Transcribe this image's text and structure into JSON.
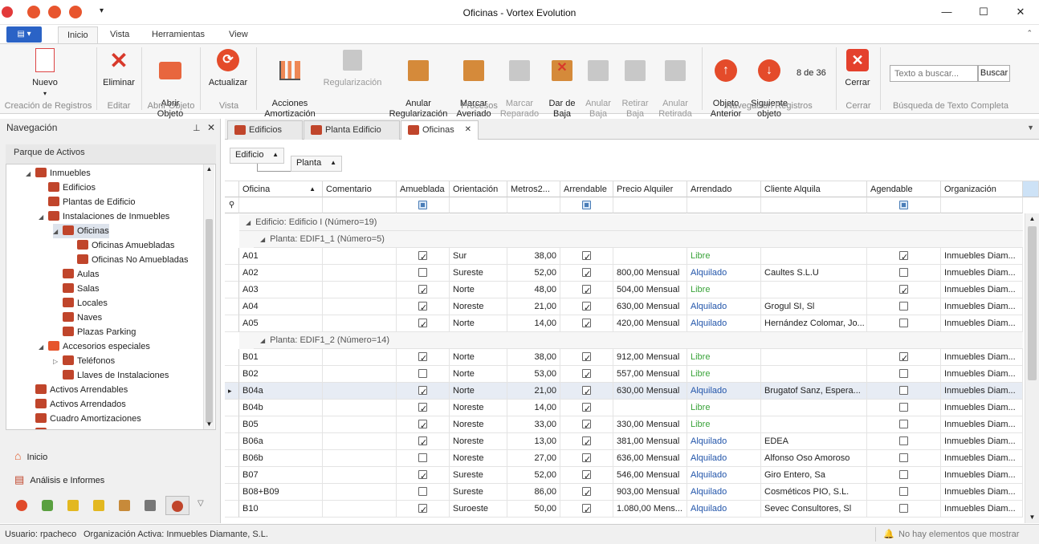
{
  "window": {
    "title": "Oficinas - Vortex Evolution"
  },
  "ribbon_tabs": [
    "Inicio",
    "Vista",
    "Herramientas",
    "View"
  ],
  "ribbon": {
    "nuevo": "Nuevo",
    "eliminar": "Eliminar",
    "abrir": "Abrir\nObjeto",
    "actualizar": "Actualizar",
    "acciones": "Acciones\nAmortización",
    "regularizacion": "Regularización",
    "anular_reg": "Anular\nRegularización",
    "marcar_averiado": "Marcar\nAveriado",
    "marcar_reparado": "Marcar\nReparado",
    "dar_baja": "Dar de\nBaja",
    "anular_baja": "Anular\nBaja",
    "retirar_baja": "Retirar\nBaja",
    "anular_retirada": "Anular\nRetirada",
    "objeto_anterior": "Objeto\nAnterior",
    "siguiente_objeto": "Siguiente\nobjeto",
    "counter": "8 de 36",
    "cerrar": "Cerrar",
    "search_placeholder": "Texto a buscar...",
    "buscar": "Buscar",
    "groups": {
      "creacion": "Creación de Registros",
      "editar": "Editar",
      "abrir": "Abrir Objeto",
      "vista": "Vista",
      "procesos": "Procesos",
      "navegacion": "Navegación Registros",
      "cerrar": "Cerrar",
      "busqueda": "Búsqueda de Texto Completa"
    }
  },
  "nav": {
    "title": "Navegación",
    "section": "Parque de Activos",
    "tree": [
      {
        "label": "Inmuebles",
        "level": 0,
        "exp": "◢"
      },
      {
        "label": "Edificios",
        "level": 1,
        "exp": ""
      },
      {
        "label": "Plantas de Edificio",
        "level": 1,
        "exp": ""
      },
      {
        "label": "Instalaciones de Inmuebles",
        "level": 1,
        "exp": "◢"
      },
      {
        "label": "Oficinas",
        "level": 2,
        "exp": "◢",
        "selected": true
      },
      {
        "label": "Oficinas Amuebladas",
        "level": 3,
        "exp": ""
      },
      {
        "label": "Oficinas No Amuebladas",
        "level": 3,
        "exp": ""
      },
      {
        "label": "Aulas",
        "level": 2,
        "exp": ""
      },
      {
        "label": "Salas",
        "level": 2,
        "exp": ""
      },
      {
        "label": "Locales",
        "level": 2,
        "exp": ""
      },
      {
        "label": "Naves",
        "level": 2,
        "exp": ""
      },
      {
        "label": "Plazas Parking",
        "level": 2,
        "exp": ""
      },
      {
        "label": "Accesorios especiales",
        "level": 1,
        "exp": "◢"
      },
      {
        "label": "Teléfonos",
        "level": 2,
        "exp": "▷"
      },
      {
        "label": "Llaves de Instalaciones",
        "level": 2,
        "exp": ""
      },
      {
        "label": "Activos Arrendables",
        "level": 0,
        "exp": ""
      },
      {
        "label": "Activos Arrendados",
        "level": 0,
        "exp": ""
      },
      {
        "label": "Cuadro Amortizaciones",
        "level": 0,
        "exp": ""
      },
      {
        "label": "Activos de Cliente",
        "level": 0,
        "exp": "▷"
      }
    ],
    "inicio": "Inicio",
    "analisis": "Análisis e Informes"
  },
  "doc_tabs": [
    "Edificios",
    "Planta Edificio",
    "Oficinas"
  ],
  "group_panel": {
    "edificio": "Edificio",
    "planta": "Planta"
  },
  "columns": [
    "Oficina",
    "Comentario",
    "Amueblada",
    "Orientación",
    "Metros2...",
    "Arrendable",
    "Precio Alquiler",
    "Arrendado",
    "Cliente Alquila",
    "Agendable",
    "Organización"
  ],
  "group1": "Edificio: Edificio I (Número=19)",
  "group2a": "Planta: EDIF1_1 (Número=5)",
  "group2b": "Planta: EDIF1_2 (Número=14)",
  "rows_a": [
    {
      "oficina": "A01",
      "amueblada": true,
      "orientacion": "Sur",
      "metros": "38,00",
      "arrendable": true,
      "precio": "",
      "estado": "Libre",
      "cliente": "",
      "agendable": true,
      "org": "Inmuebles Diam..."
    },
    {
      "oficina": "A02",
      "amueblada": false,
      "orientacion": "Sureste",
      "metros": "52,00",
      "arrendable": true,
      "precio": "800,00 Mensual",
      "estado": "Alquilado",
      "cliente": "Caultes S.L.U",
      "agendable": false,
      "org": "Inmuebles Diam..."
    },
    {
      "oficina": "A03",
      "amueblada": true,
      "orientacion": "Norte",
      "metros": "48,00",
      "arrendable": true,
      "precio": "504,00 Mensual",
      "estado": "Libre",
      "cliente": "",
      "agendable": true,
      "org": "Inmuebles Diam..."
    },
    {
      "oficina": "A04",
      "amueblada": true,
      "orientacion": "Noreste",
      "metros": "21,00",
      "arrendable": true,
      "precio": "630,00 Mensual",
      "estado": "Alquilado",
      "cliente": "Grogul SI, Sl",
      "agendable": false,
      "org": "Inmuebles Diam..."
    },
    {
      "oficina": "A05",
      "amueblada": true,
      "orientacion": "Norte",
      "metros": "14,00",
      "arrendable": true,
      "precio": "420,00 Mensual",
      "estado": "Alquilado",
      "cliente": "Hernández Colomar, Jo...",
      "agendable": false,
      "org": "Inmuebles Diam..."
    }
  ],
  "rows_b": [
    {
      "oficina": "B01",
      "amueblada": true,
      "orientacion": "Norte",
      "metros": "38,00",
      "arrendable": true,
      "precio": "912,00 Mensual",
      "estado": "Libre",
      "cliente": "",
      "agendable": true,
      "org": "Inmuebles Diam..."
    },
    {
      "oficina": "B02",
      "amueblada": false,
      "orientacion": "Norte",
      "metros": "53,00",
      "arrendable": true,
      "precio": "557,00 Mensual",
      "estado": "Libre",
      "cliente": "",
      "agendable": false,
      "org": "Inmuebles Diam..."
    },
    {
      "oficina": "B04a",
      "amueblada": true,
      "orientacion": "Norte",
      "metros": "21,00",
      "arrendable": true,
      "precio": "630,00 Mensual",
      "estado": "Alquilado",
      "cliente": "Brugatof Sanz, Espera...",
      "agendable": false,
      "org": "Inmuebles Diam...",
      "selected": true
    },
    {
      "oficina": "B04b",
      "amueblada": true,
      "orientacion": "Noreste",
      "metros": "14,00",
      "arrendable": true,
      "precio": "",
      "estado": "Libre",
      "cliente": "",
      "agendable": false,
      "org": "Inmuebles Diam..."
    },
    {
      "oficina": "B05",
      "amueblada": true,
      "orientacion": "Noreste",
      "metros": "33,00",
      "arrendable": true,
      "precio": "330,00 Mensual",
      "estado": "Libre",
      "cliente": "",
      "agendable": false,
      "org": "Inmuebles Diam..."
    },
    {
      "oficina": "B06a",
      "amueblada": true,
      "orientacion": "Noreste",
      "metros": "13,00",
      "arrendable": true,
      "precio": "381,00 Mensual",
      "estado": "Alquilado",
      "cliente": "EDEA",
      "agendable": false,
      "org": "Inmuebles Diam..."
    },
    {
      "oficina": "B06b",
      "amueblada": false,
      "orientacion": "Noreste",
      "metros": "27,00",
      "arrendable": true,
      "precio": "636,00 Mensual",
      "estado": "Alquilado",
      "cliente": "Alfonso Oso Amoroso",
      "agendable": false,
      "org": "Inmuebles Diam..."
    },
    {
      "oficina": "B07",
      "amueblada": true,
      "orientacion": "Sureste",
      "metros": "52,00",
      "arrendable": true,
      "precio": "546,00 Mensual",
      "estado": "Alquilado",
      "cliente": "Giro Entero, Sa",
      "agendable": false,
      "org": "Inmuebles Diam..."
    },
    {
      "oficina": "B08+B09",
      "amueblada": false,
      "orientacion": "Sureste",
      "metros": "86,00",
      "arrendable": true,
      "precio": "903,00 Mensual",
      "estado": "Alquilado",
      "cliente": "Cosméticos PIO, S.L.",
      "agendable": false,
      "org": "Inmuebles Diam..."
    },
    {
      "oficina": "B10",
      "amueblada": true,
      "orientacion": "Suroeste",
      "metros": "50,00",
      "arrendable": true,
      "precio": "1.080,00 Mens...",
      "estado": "Alquilado",
      "cliente": "Sevec Consultores, Sl",
      "agendable": false,
      "org": "Inmuebles Diam..."
    }
  ],
  "status": {
    "user": "Usuario: rpacheco",
    "org": "Organización Activa: Inmuebles Diamante, S.L.",
    "notif": "No hay elementos que mostrar"
  },
  "colors": {
    "accent": "#2b63c6",
    "libre": "#3aa33a",
    "alquilado": "#2255aa",
    "danger": "#e44b2a"
  }
}
